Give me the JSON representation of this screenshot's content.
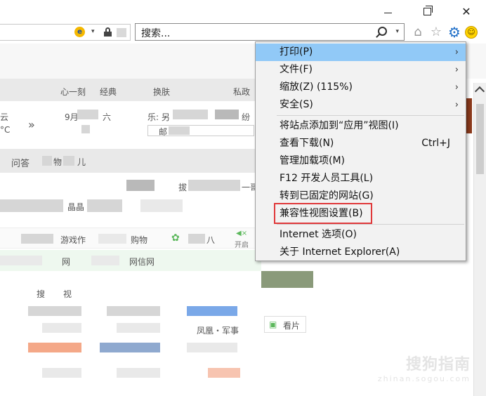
{
  "window": {
    "minimize_icon": "minimize-icon",
    "restore_icon": "restore-icon",
    "close_glyph": "✕"
  },
  "address_bar": {
    "dropdown_glyph": "▾"
  },
  "search": {
    "placeholder": "搜索...",
    "dropdown_glyph": "▾"
  },
  "toolbar": {
    "home_glyph": "⌂",
    "favorites_glyph": "☆",
    "tools_glyph": "⚙",
    "smiley_glyph": "☺"
  },
  "menu": {
    "items": [
      {
        "label": "打印(P)",
        "has_submenu": true,
        "selected": true
      },
      {
        "label": "文件(F)",
        "has_submenu": true
      },
      {
        "label": "缩放(Z) (115%)",
        "has_submenu": true
      },
      {
        "label": "安全(S)",
        "has_submenu": true
      },
      {
        "label": "将站点添加到“应用”视图(I)"
      },
      {
        "label": "查看下载(N)",
        "shortcut": "Ctrl+J"
      },
      {
        "label": "管理加载项(M)"
      },
      {
        "label": "F12 开发人员工具(L)"
      },
      {
        "label": "转到已固定的网站(G)"
      },
      {
        "label": "兼容性视图设置(B)",
        "highlighted": true
      },
      {
        "label": "Internet 选项(O)"
      },
      {
        "label": "关于 Internet Explorer(A)"
      }
    ],
    "submenu_glyph": "›",
    "highlight_color": "#e0383a",
    "selected_color": "#91c9f7"
  },
  "page": {
    "texts": {
      "t1": "心一刻",
      "t2": "经典",
      "t3": "换肤",
      "t4": "私政",
      "t5": "云",
      "t6": "°C",
      "t7": "9月",
      "t8": "六",
      "t9": "乐: 另",
      "t10": "纷",
      "t11": "问答",
      "t12": "物",
      "t13": "儿",
      "t14": "拔",
      "t15": "一哥",
      "t16": "晶晶",
      "t17": "游戏作",
      "t18": "购物",
      "t19": "八",
      "t20": "开启",
      "t21": "网",
      "t22": "网信网",
      "t23": "搜",
      "t24": "视",
      "t25": "凤凰・军事",
      "t26": "看片",
      "t27": "邮",
      "t28": "»"
    },
    "watermark_title": "搜狗指南",
    "watermark_url": "zhinan.sogou.com"
  }
}
